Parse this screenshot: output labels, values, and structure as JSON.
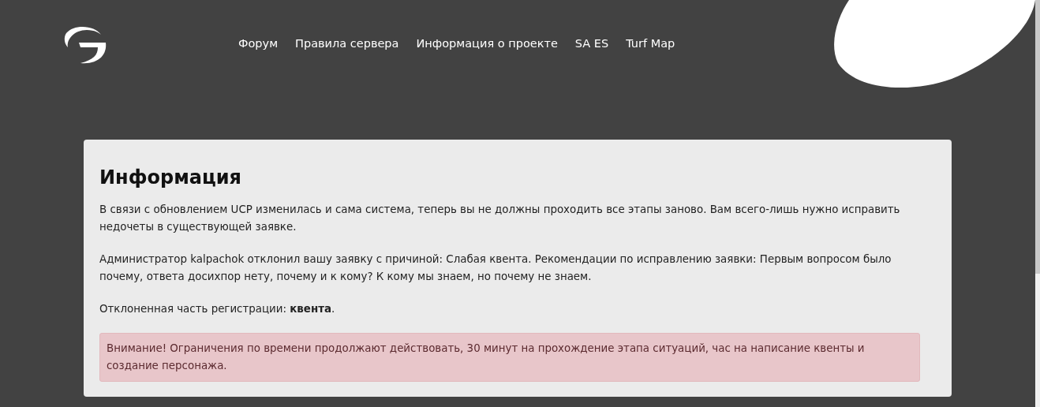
{
  "nav": [
    {
      "label": "Форум"
    },
    {
      "label": "Правила сервера"
    },
    {
      "label": "Информация о проекте"
    },
    {
      "label": "SA ES"
    },
    {
      "label": "Turf Map"
    }
  ],
  "info_card": {
    "title": "Информация",
    "paragraphs": [
      "В связи с обновлением UCP изменилась и сама система, теперь вы не должны проходить все этапы заново. Вам всего-лишь нужно исправить недочеты в существующей заявке.",
      "Администратор kalpachok отклонил вашу заявку с причиной: Слабая квента. Рекомендации по исправлению заявки: Первым вопросом было почему, ответа досихпор нету, почему и к кому? К кому мы знаем, но почему не знаем.",
      "Отклоненная часть регистрации: **квента**."
    ],
    "alert": {
      "kind": "danger",
      "text": "Внимание! Ограничения по времени продолжают действовать, 30 минут на прохождение этапа ситуаций, час на написание квенты и создание персонажа."
    }
  }
}
